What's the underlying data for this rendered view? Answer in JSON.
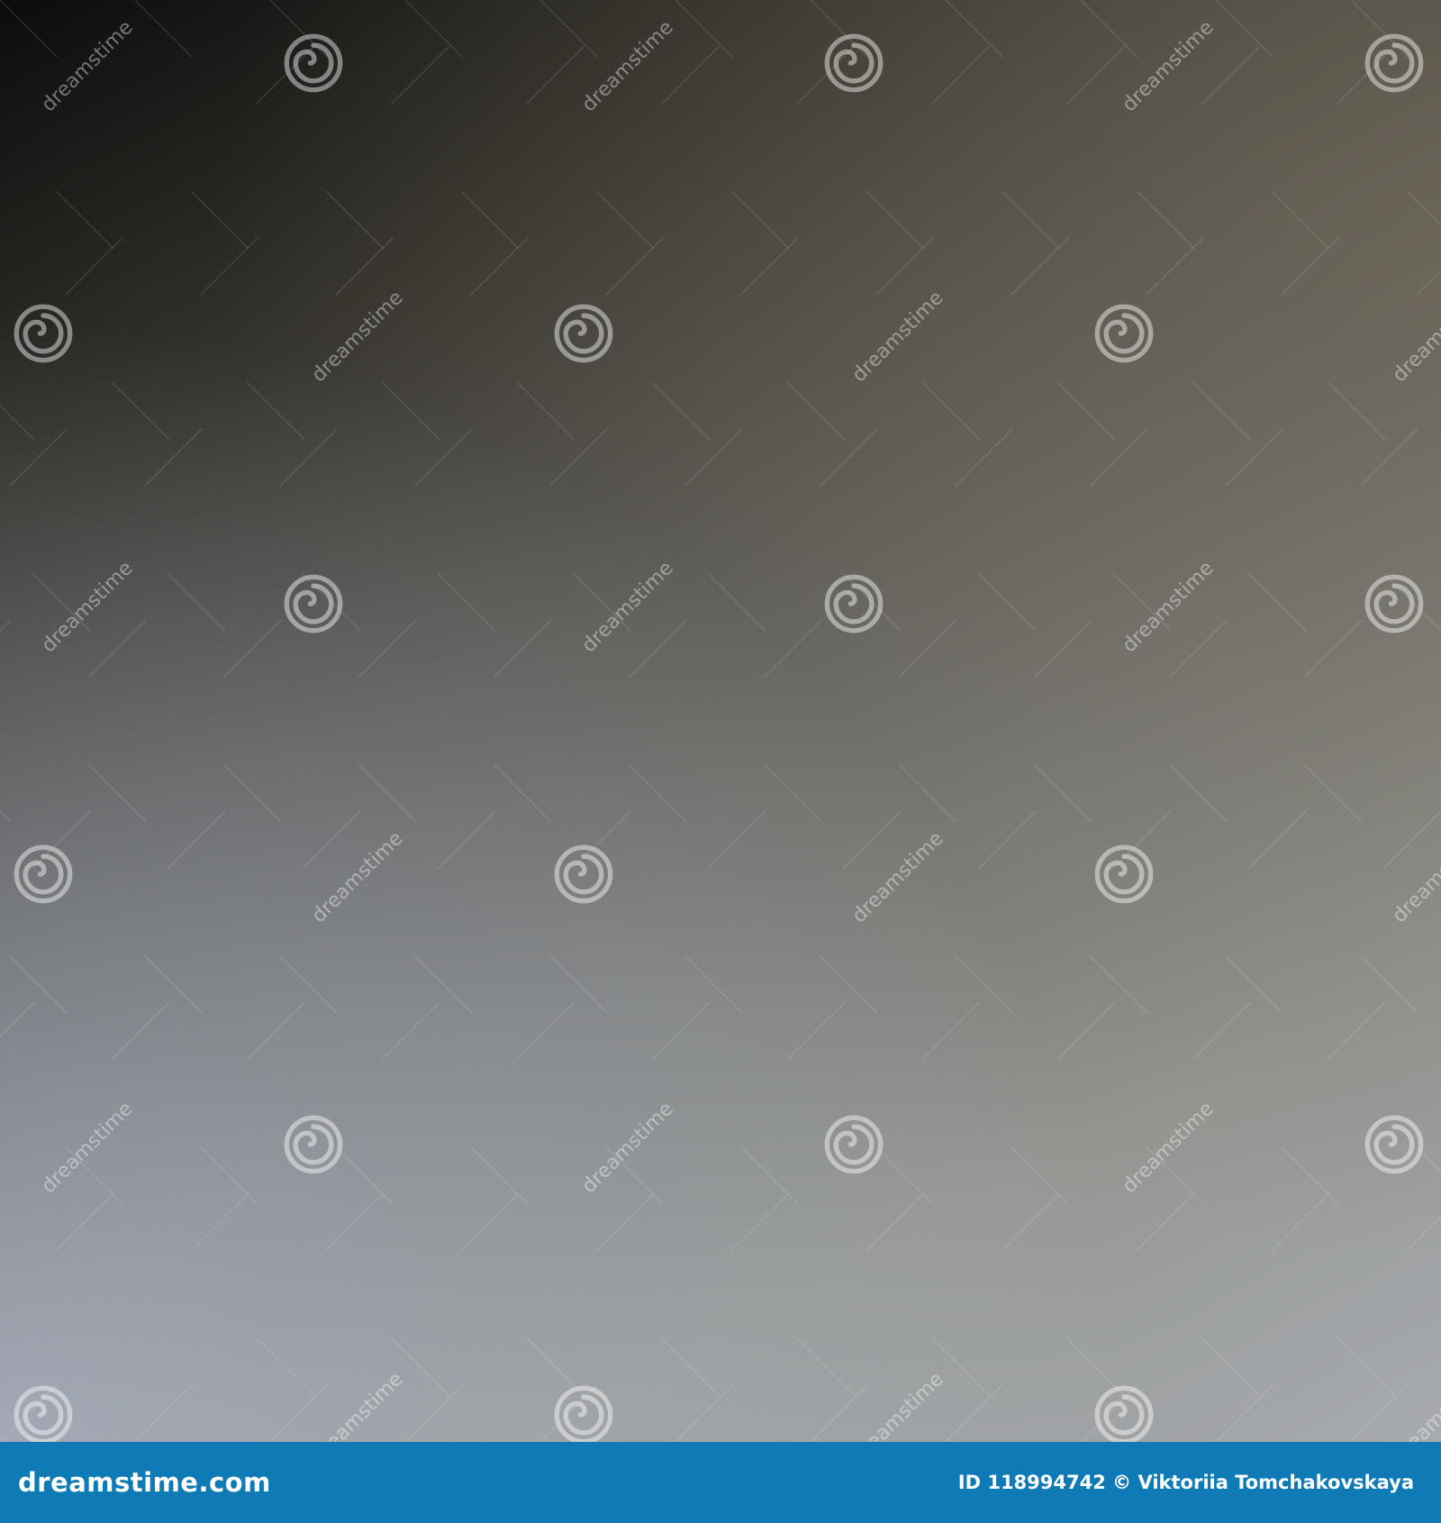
{
  "image": {
    "description_colors": {
      "top_left": "#0c0c0c",
      "middle": "#6b6b68",
      "bottom_left": "#b2b9cc",
      "bottom_right": "#9a9a92"
    },
    "watermark": {
      "logo_icon": "dreamstime-spiral-icon",
      "text": "dreamstime",
      "color": "#ffffff"
    }
  },
  "footer": {
    "background": "#0e7ab6",
    "brand": "dreamstime.com",
    "credit": "ID 118994742 © Viktoriia Tomchakovskaya"
  }
}
